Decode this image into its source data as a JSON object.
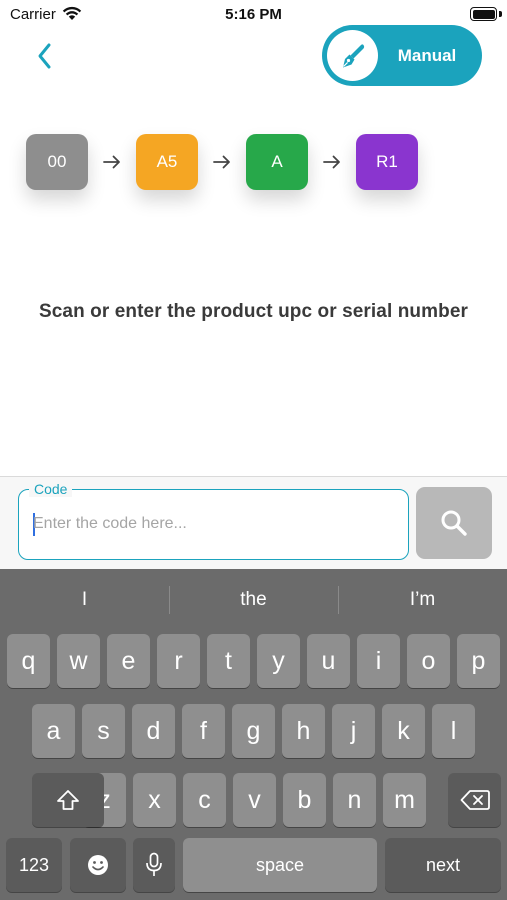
{
  "status_bar": {
    "carrier": "Carrier",
    "time": "5:16 PM"
  },
  "header": {
    "manual_label": "Manual"
  },
  "steps": [
    {
      "label": "00",
      "color": "#8e8e8e"
    },
    {
      "label": "A5",
      "color": "#f5a623"
    },
    {
      "label": "A",
      "color": "#27a84a"
    },
    {
      "label": "R1",
      "color": "#8a35cf"
    }
  ],
  "instruction": "Scan or enter the product upc or serial number",
  "code_field": {
    "label": "Code",
    "placeholder": "Enter the code here...",
    "value": ""
  },
  "keyboard": {
    "suggestions": [
      "I",
      "the",
      "I’m"
    ],
    "row1": [
      "q",
      "w",
      "e",
      "r",
      "t",
      "y",
      "u",
      "i",
      "o",
      "p"
    ],
    "row2": [
      "a",
      "s",
      "d",
      "f",
      "g",
      "h",
      "j",
      "k",
      "l"
    ],
    "row3": [
      "z",
      "x",
      "c",
      "v",
      "b",
      "n",
      "m"
    ],
    "numbers_key": "123",
    "space_key": "space",
    "return_key": "next"
  },
  "colors": {
    "accent": "#1ba3bd",
    "keyboard_bg": "#6b6b6b",
    "key_bg": "#8f8f8f",
    "fn_key_bg": "#5b5b5b"
  }
}
